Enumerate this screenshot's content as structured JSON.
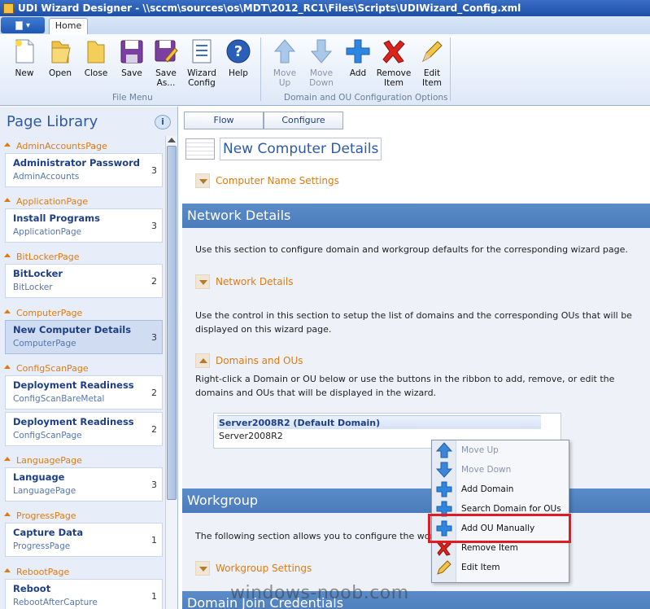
{
  "window": {
    "title": "UDI Wizard Designer - \\\\sccm\\sources\\os\\MDT\\2012_RC1\\Files\\Scripts\\UDIWizard_Config.xml"
  },
  "ribbon": {
    "tab_home": "Home",
    "file_buttons": [
      {
        "label": "New",
        "icon": "new-document-icon"
      },
      {
        "label": "Open",
        "icon": "open-folder-icon"
      },
      {
        "label": "Close",
        "icon": "close-folder-icon"
      },
      {
        "label": "Save",
        "icon": "save-icon"
      },
      {
        "label": "Save As...",
        "icon": "save-as-icon"
      },
      {
        "label": "Wizard Config",
        "icon": "wizard-config-icon"
      },
      {
        "label": "Help",
        "icon": "help-icon"
      }
    ],
    "file_group_label": "File Menu",
    "domain_buttons": [
      {
        "label": "Move Up",
        "icon": "arrow-up-icon",
        "enabled": false
      },
      {
        "label": "Move Down",
        "icon": "arrow-down-icon",
        "enabled": false
      },
      {
        "label": "Add",
        "icon": "add-icon",
        "enabled": true
      },
      {
        "label": "Remove Item",
        "icon": "remove-icon",
        "enabled": true
      },
      {
        "label": "Edit Item",
        "icon": "edit-icon",
        "enabled": true
      }
    ],
    "domain_group_label": "Domain and OU Configuration Options"
  },
  "page_library": {
    "title": "Page Library",
    "groups": [
      {
        "category": "AdminAccountsPage",
        "items": [
          {
            "title": "Administrator Password",
            "subtitle": "AdminAccounts",
            "count": "3"
          }
        ]
      },
      {
        "category": "ApplicationPage",
        "items": [
          {
            "title": "Install Programs",
            "subtitle": "ApplicationPage",
            "count": "3"
          }
        ]
      },
      {
        "category": "BitLockerPage",
        "items": [
          {
            "title": "BitLocker",
            "subtitle": "BitLocker",
            "count": "2"
          }
        ]
      },
      {
        "category": "ComputerPage",
        "items": [
          {
            "title": "New Computer Details",
            "subtitle": "ComputerPage",
            "count": "3",
            "selected": true
          }
        ]
      },
      {
        "category": "ConfigScanPage",
        "items": [
          {
            "title": "Deployment Readiness",
            "subtitle": "ConfigScanBareMetal",
            "count": "2"
          },
          {
            "title": "Deployment Readiness",
            "subtitle": "ConfigScanPage",
            "count": "2"
          }
        ]
      },
      {
        "category": "LanguagePage",
        "items": [
          {
            "title": "Language",
            "subtitle": "LanguagePage",
            "count": "3"
          }
        ]
      },
      {
        "category": "ProgressPage",
        "items": [
          {
            "title": "Capture Data",
            "subtitle": "ProgressPage",
            "count": "1"
          }
        ]
      },
      {
        "category": "RebootPage",
        "items": [
          {
            "title": "Reboot",
            "subtitle": "RebootAfterCapture",
            "count": "1"
          }
        ]
      }
    ]
  },
  "content": {
    "tabs": [
      "Flow",
      "Configure"
    ],
    "page_title": "New Computer Details",
    "computer_name_expander": "Computer Name Settings",
    "network_band": "Network Details",
    "network_desc": "Use this section to configure domain and workgroup defaults for the corresponding wizard page.",
    "network_expander": "Network Details",
    "domains_desc": "Use the control in this section to setup the list of domains and the corresponding OUs that will be displayed on this wizard page.",
    "domains_expander": "Domains and OUs",
    "domains_help": "Right-click a Domain or OU below or use the buttons in the ribbon to add, remove, or edit the domains and OUs that will be displayed in the wizard.",
    "domain_list": [
      "Server2008R2 (Default Domain)",
      "Server2008R2"
    ],
    "workgroup_band": "Workgroup",
    "workgroup_desc": "The following section allows you to configure the workgroup",
    "workgroup_expander": "Workgroup Settings",
    "domain_join_band": "Domain Join Credentials"
  },
  "context_menu": {
    "items": [
      {
        "label": "Move Up",
        "icon": "arrow-up-icon",
        "enabled": false
      },
      {
        "label": "Move Down",
        "icon": "arrow-down-icon",
        "enabled": false
      },
      {
        "label": "Add Domain",
        "icon": "add-icon",
        "enabled": true
      },
      {
        "label": "Search Domain for OUs",
        "icon": "add-icon",
        "enabled": true
      },
      {
        "label": "Add OU Manually",
        "icon": "add-icon",
        "enabled": true,
        "highlighted": true
      },
      {
        "label": "Remove Item",
        "icon": "remove-icon",
        "enabled": true
      },
      {
        "label": "Edit Item",
        "icon": "edit-icon",
        "enabled": true
      }
    ]
  },
  "watermark": "windows-noob.com",
  "colors": {
    "accent_blue": "#4a7bbc",
    "orange": "#e07a10",
    "highlight_red": "#e11b22"
  }
}
